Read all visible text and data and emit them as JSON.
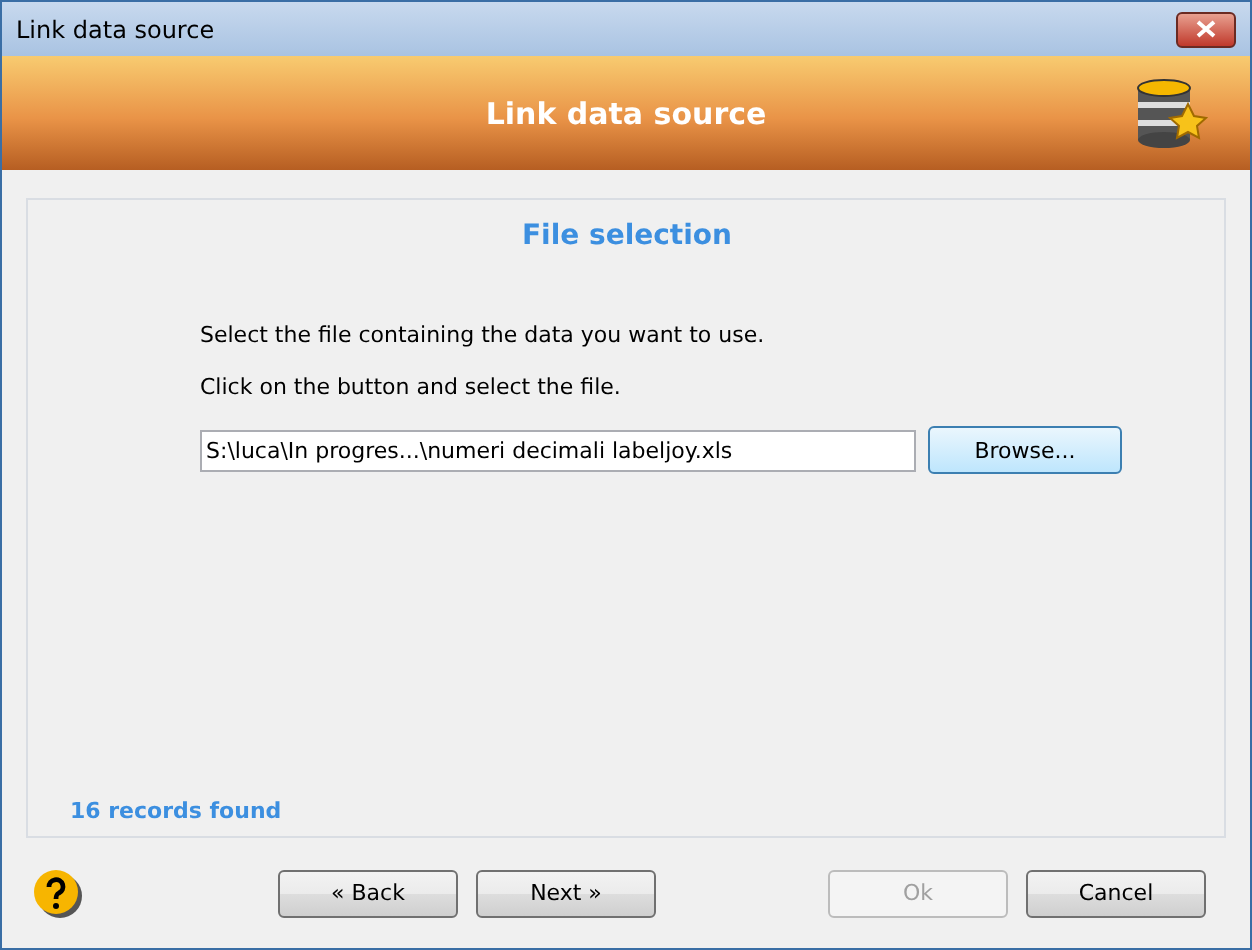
{
  "window": {
    "title": "Link data source"
  },
  "banner": {
    "title": "Link data source"
  },
  "panel": {
    "heading": "File selection",
    "instructions": [
      "Select the file containing the data you want to use.",
      "Click on the button and select the file."
    ],
    "file_field": {
      "value": "S:\\luca\\In progres...\\numeri decimali labeljoy.xls"
    },
    "browse_button": {
      "label": "Browse...",
      "focused": true
    },
    "status": "16 records found"
  },
  "nav_buttons": [
    {
      "label": "« Back",
      "disabled": false
    },
    {
      "label": "Next »",
      "disabled": false
    }
  ],
  "action_buttons": [
    {
      "label": "Ok",
      "disabled": true
    },
    {
      "label": "Cancel",
      "disabled": false
    }
  ]
}
